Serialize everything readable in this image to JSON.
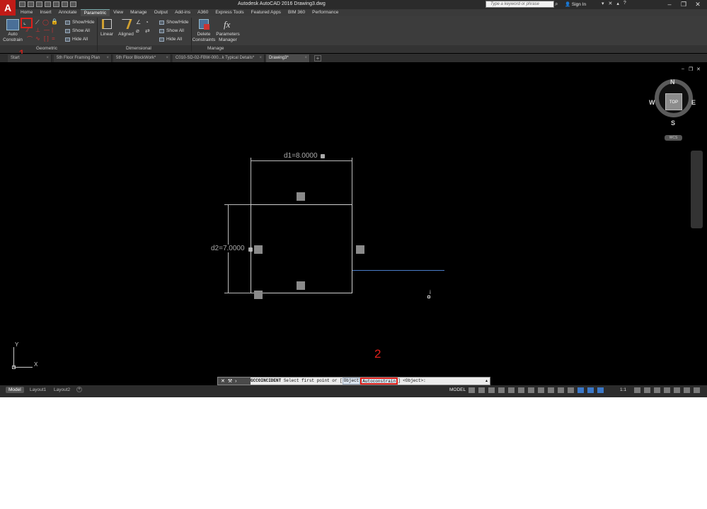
{
  "titlebar": {
    "app_letter": "A",
    "title": "Autodesk AutoCAD 2016   Drawing3.dwg",
    "search_placeholder": "Type a keyword or phrase",
    "sign_in": "Sign In",
    "search_icon": "binoculars-icon"
  },
  "ribbon_tabs": [
    "Home",
    "Insert",
    "Annotate",
    "Parametric",
    "View",
    "Manage",
    "Output",
    "Add-ins",
    "A360",
    "Express Tools",
    "Featured Apps",
    "BIM 360",
    "Performance"
  ],
  "ribbon_active_tab": "Parametric",
  "ribbon": {
    "auto_constrain": "Auto\nConstrain",
    "geometric_show_hide": "Show/Hide",
    "geometric_show_all": "Show All",
    "geometric_hide_all": "Hide All",
    "linear": "Linear",
    "aligned": "Aligned",
    "dim_show_hide": "Show/Hide",
    "dim_show_all": "Show All",
    "dim_hide_all": "Hide All",
    "delete_constraints": "Delete\nConstraints",
    "parameters_manager": "Parameters\nManager",
    "fx": "fx",
    "panel_geometric": "Geometric",
    "panel_dimensional": "Dimensional",
    "panel_manage": "Manage"
  },
  "doc_tabs": [
    {
      "label": "Start",
      "active": false
    },
    {
      "label": "5th Floor Framing Plan",
      "active": false
    },
    {
      "label": "5th Floor BlockWork*",
      "active": false
    },
    {
      "label": "C010-SD-02-FBW-000...k Typical Details*",
      "active": false
    },
    {
      "label": "Drawing3*",
      "active": true
    }
  ],
  "annotations": {
    "one": "1",
    "two": "2"
  },
  "viewcube": {
    "north": "N",
    "south": "S",
    "east": "E",
    "west": "W",
    "top": "TOP",
    "wcs": "WCS"
  },
  "drawing": {
    "d1": "d1=8.0000",
    "d2": "d2=7.0000"
  },
  "ucs": {
    "x": "X",
    "y": "Y"
  },
  "command": {
    "name": "GCCOINCIDENT",
    "prompt": "Select first point or [",
    "opt_object": "Object",
    "opt_autoconstrain": "Autoconstrain",
    "suffix": "] <Object>:"
  },
  "layout_tabs": [
    "Model",
    "Layout1",
    "Layout2"
  ],
  "status": {
    "model": "MODEL",
    "scale": "1:1"
  },
  "colors": {
    "brand_red": "#c11b17",
    "annotation_red": "#e0201a",
    "track_blue": "#4a7cc9"
  }
}
